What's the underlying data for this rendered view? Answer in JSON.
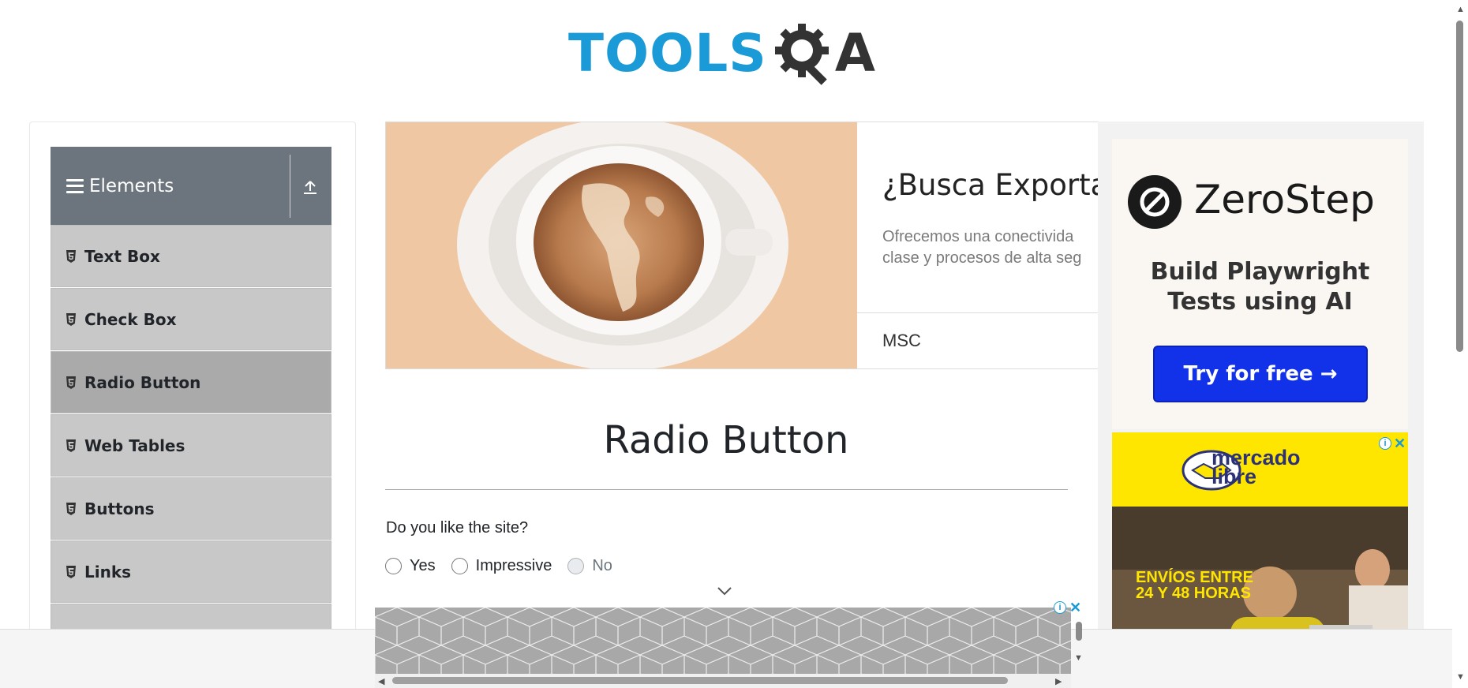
{
  "logo": {
    "text_main": "TOOLS",
    "text_suffix": "A"
  },
  "sidebar": {
    "group_title": "Elements",
    "items": [
      {
        "label": "Text Box",
        "active": false
      },
      {
        "label": "Check Box",
        "active": false
      },
      {
        "label": "Radio Button",
        "active": true
      },
      {
        "label": "Web Tables",
        "active": false
      },
      {
        "label": "Buttons",
        "active": false
      },
      {
        "label": "Links",
        "active": false
      }
    ]
  },
  "ad_banner": {
    "title": "¿Busca Exportar",
    "description_line1": "Ofrecemos una conectivida",
    "description_line2": "clase y procesos de alta seg",
    "brand": "MSC"
  },
  "main": {
    "title": "Radio Button",
    "question": "Do you like the site?",
    "options": [
      {
        "label": "Yes",
        "disabled": false
      },
      {
        "label": "Impressive",
        "disabled": false
      },
      {
        "label": "No",
        "disabled": true
      }
    ]
  },
  "ad_right": {
    "zerostep": {
      "name": "ZeroStep",
      "tagline_line1": "Build Playwright",
      "tagline_line2": "Tests using AI",
      "cta": "Try for free →"
    },
    "mercado": {
      "brand_line1": "mercado",
      "brand_line2": "libre",
      "promo_line1": "ENVÍOS ENTRE",
      "promo_line2": "24 Y 48 HORAS"
    }
  },
  "colors": {
    "brand_blue": "#1a9ad6",
    "sidebar_header": "#6c757d",
    "menu_item": "#c8c8c8",
    "menu_item_active": "#aaaaaa",
    "cta_blue": "#1132e8",
    "mercado_yellow": "#ffe600"
  },
  "icons": [
    "hamburger-icon",
    "upload-icon",
    "html5-icon",
    "gear-magnifier-icon",
    "chevron-down-icon",
    "ad-info-icon",
    "close-icon"
  ]
}
